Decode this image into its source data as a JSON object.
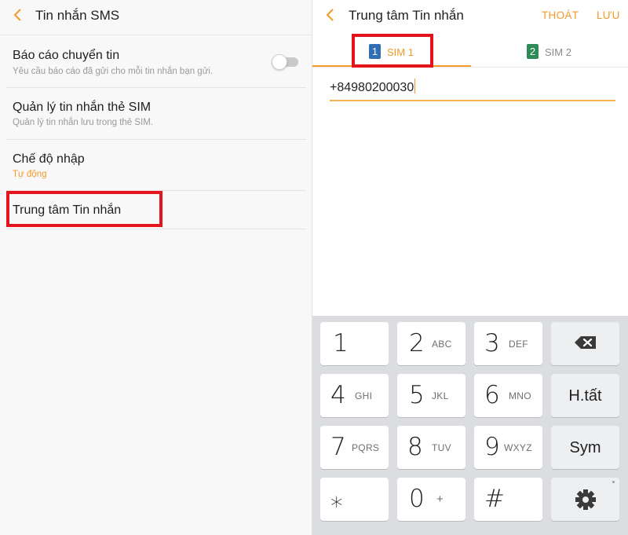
{
  "left": {
    "title": "Tin nhắn SMS",
    "items": [
      {
        "title": "Báo cáo chuyển tin",
        "subtitle": "Yêu cầu báo cáo đã gửi cho mỗi tin nhắn bạn gửi."
      },
      {
        "title": "Quản lý tin nhắn thẻ SIM",
        "subtitle": "Quản lý tin nhắn lưu trong thẻ SIM."
      },
      {
        "title": "Chế độ nhập",
        "subtitle": "Tự động"
      },
      {
        "title": "Trung tâm Tin nhắn"
      }
    ],
    "toggle_on": false
  },
  "right": {
    "title": "Trung tâm Tin nhắn",
    "exit_label": "THOÁT",
    "save_label": "LƯU",
    "tabs": [
      {
        "badge": "1",
        "label": "SIM 1",
        "color": "#2f6db5"
      },
      {
        "badge": "2",
        "label": "SIM 2",
        "color": "#2e8b57"
      }
    ],
    "selected_tab": "SIM 1",
    "number": "+84980200030"
  },
  "keypad": {
    "keys": [
      {
        "num": "1",
        "sub": ""
      },
      {
        "num": "2",
        "sub": "ABC"
      },
      {
        "num": "3",
        "sub": "DEF"
      },
      {
        "num": "4",
        "sub": "GHI"
      },
      {
        "num": "5",
        "sub": "JKL"
      },
      {
        "num": "6",
        "sub": "MNO"
      },
      {
        "num": "7",
        "sub": "PQRS"
      },
      {
        "num": "8",
        "sub": "TUV"
      },
      {
        "num": "9",
        "sub": "WXYZ"
      },
      {
        "num": "⁎",
        "sub": ""
      },
      {
        "num": "0",
        "sub": "+"
      },
      {
        "num": "#",
        "sub": ""
      }
    ],
    "done_label": "H.tất",
    "sym_label": "Sym"
  },
  "colors": {
    "accent": "#f39a2b",
    "highlight": "#e3141c"
  }
}
